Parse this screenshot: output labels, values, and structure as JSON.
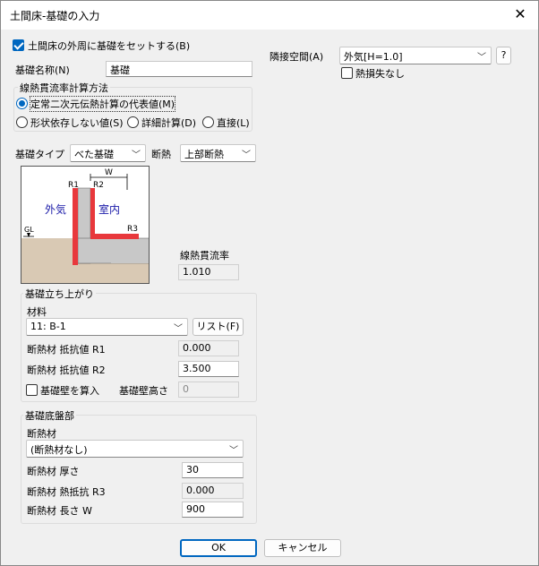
{
  "window": {
    "title": "土間床-基礎の入力",
    "close_glyph": "✕"
  },
  "outer_checkbox": {
    "label": "土間床の外周に基礎をセットする(B)",
    "checked": true
  },
  "name": {
    "label": "基礎名称(N)",
    "value": "基礎"
  },
  "method": {
    "title": "線熱貫流率計算方法",
    "options": [
      {
        "label": "定常二次元伝熱計算の代表値(M)",
        "selected": true
      },
      {
        "label": "形状依存しない値(S)",
        "selected": false
      },
      {
        "label": "詳細計算(D)",
        "selected": false
      },
      {
        "label": "直接(L)",
        "selected": false
      }
    ]
  },
  "adjacent": {
    "label": "隣接空間(A)",
    "value": "外気[H=1.0]",
    "help_label": "?",
    "no_loss_label": "熱損失なし",
    "no_loss_checked": false
  },
  "foundation_type": {
    "label": "基礎タイプ",
    "value": "べた基礎"
  },
  "insulation": {
    "label": "断熱",
    "value": "上部断熱"
  },
  "diagram": {
    "outside_label": "外気",
    "inside_label": "室内",
    "r1": "R1",
    "r2": "R2",
    "r3": "R3",
    "w": "W",
    "gl": "GL",
    "colors": {
      "soil": "#d9c9b4",
      "concrete": "#c8c8c8",
      "insulation": "#e8383c",
      "text": "#1a1aa8"
    }
  },
  "psi": {
    "label": "線熱貫流率",
    "value": "1.010"
  },
  "rise": {
    "title": "基礎立ち上がり",
    "material_label": "材料",
    "material_value": "11: B-1",
    "list_button": "リスト(F)",
    "r1_label": "断熱材  抵抗値  R1",
    "r1_value": "0.000",
    "r2_label": "断熱材  抵抗値  R2",
    "r2_value": "3.500",
    "wall_checkbox_label": "基礎壁を算入",
    "wall_checked": false,
    "wall_height_label": "基礎壁高さ",
    "wall_height_value": "0"
  },
  "slab": {
    "title": "基礎底盤部",
    "insulation_label": "断熱材",
    "insulation_value": "(断熱材なし)",
    "thickness_label": "断熱材 厚さ",
    "thickness_value": "30",
    "r3_label": "断熱材 熱抵抗  R3",
    "r3_value": "0.000",
    "length_label": "断熱材 長さ W",
    "length_value": "900"
  },
  "footer": {
    "ok": "OK",
    "cancel": "キャンセル"
  },
  "chevron_glyph": "﹀"
}
